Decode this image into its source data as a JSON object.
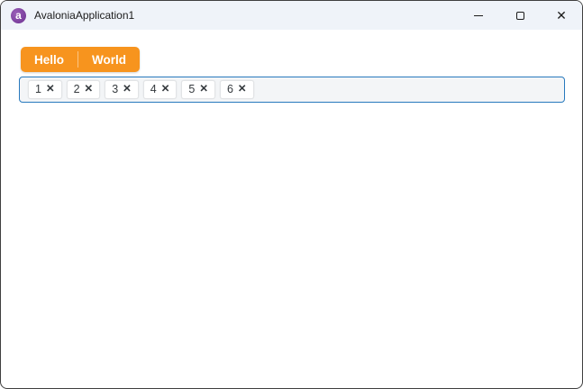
{
  "window": {
    "title": "AvaloniaApplication1",
    "app_icon": "avalonia-logo",
    "app_icon_glyph": "a",
    "controls": {
      "minimize_icon": "minimize",
      "maximize_icon": "maximize",
      "close_icon": "✕"
    }
  },
  "tabs": {
    "items": [
      {
        "label": "Hello"
      },
      {
        "label": "World"
      }
    ]
  },
  "tag_box": {
    "items": [
      {
        "label": "1"
      },
      {
        "label": "2"
      },
      {
        "label": "3"
      },
      {
        "label": "4"
      },
      {
        "label": "5"
      },
      {
        "label": "6"
      }
    ],
    "remove_icon": "✕"
  },
  "colors": {
    "accent_orange": "#F7941E",
    "focus_border": "#2779BD",
    "titlebar_bg": "#EFF3F9",
    "tagbox_bg": "#F3F5F7",
    "chip_bg": "#FFFFFF",
    "window_border": "#3F3F3F",
    "avalonia_purple": "#7B3F9D"
  }
}
